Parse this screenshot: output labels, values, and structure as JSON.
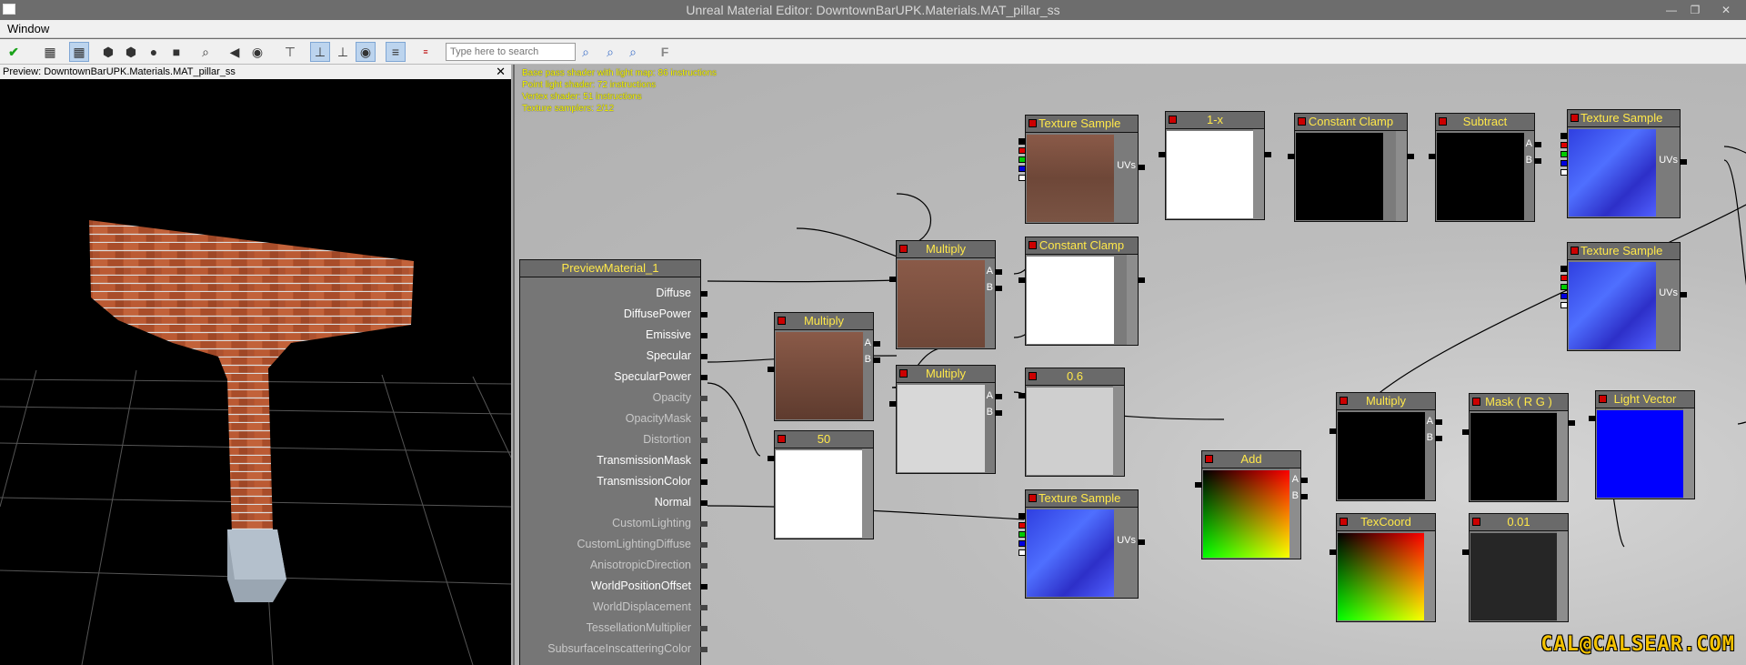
{
  "window": {
    "title": "Unreal Material Editor: DowntownBarUPK.Materials.MAT_pillar_ss"
  },
  "menu": {
    "items": [
      "Window"
    ]
  },
  "toolbar": {
    "search_placeholder": "Type here to search",
    "find_label": "F"
  },
  "preview": {
    "title": "Preview: DowntownBarUPK.Materials.MAT_pillar_ss",
    "close": "✕"
  },
  "stats": {
    "line1": "Base pass shader with light map: 86 instructions",
    "line2": "Point light shader: 72 instructions",
    "line3": "Vertex shader: 51 instructions",
    "line4": "Texture samplers: 2/12"
  },
  "material": {
    "title": "PreviewMaterial_1",
    "inputs": [
      {
        "label": "Diffuse",
        "active": true
      },
      {
        "label": "DiffusePower",
        "active": true
      },
      {
        "label": "Emissive",
        "active": true
      },
      {
        "label": "Specular",
        "active": true
      },
      {
        "label": "SpecularPower",
        "active": true
      },
      {
        "label": "Opacity",
        "active": false
      },
      {
        "label": "OpacityMask",
        "active": false
      },
      {
        "label": "Distortion",
        "active": false
      },
      {
        "label": "TransmissionMask",
        "active": true
      },
      {
        "label": "TransmissionColor",
        "active": true
      },
      {
        "label": "Normal",
        "active": true
      },
      {
        "label": "CustomLighting",
        "active": false
      },
      {
        "label": "CustomLightingDiffuse",
        "active": false
      },
      {
        "label": "AnisotropicDirection",
        "active": false
      },
      {
        "label": "WorldPositionOffset",
        "active": true
      },
      {
        "label": "WorldDisplacement",
        "active": false
      },
      {
        "label": "TessellationMultiplier",
        "active": false
      },
      {
        "label": "SubsurfaceInscatteringColor",
        "active": false
      }
    ]
  },
  "nodes": {
    "tex1": {
      "title": "Texture Sample",
      "pin": "UVs"
    },
    "oneminus": {
      "title": "1-x"
    },
    "clamp1": {
      "title": "Constant Clamp"
    },
    "subtract": {
      "title": "Subtract",
      "a": "A",
      "b": "B"
    },
    "tex_top": {
      "title": "Texture Sample",
      "pin": "UVs"
    },
    "mult1": {
      "title": "Multiply",
      "a": "A",
      "b": "B"
    },
    "clamp2": {
      "title": "Constant Clamp"
    },
    "tex_mid": {
      "title": "Texture Sample",
      "pin": "UVs"
    },
    "mult2": {
      "title": "Multiply",
      "a": "A",
      "b": "B"
    },
    "mult3": {
      "title": "Multiply",
      "a": "A",
      "b": "B"
    },
    "c06": {
      "title": "0.6"
    },
    "c50": {
      "title": "50"
    },
    "tex_normal": {
      "title": "Texture Sample",
      "pin": "UVs"
    },
    "add": {
      "title": "Add",
      "a": "A",
      "b": "B"
    },
    "mult4": {
      "title": "Multiply",
      "a": "A",
      "b": "B"
    },
    "mask": {
      "title": "Mask ( R G )"
    },
    "lightvec": {
      "title": "Light Vector"
    },
    "texcoord": {
      "title": "TexCoord"
    },
    "c001": {
      "title": "0.01"
    }
  },
  "watermark": {
    "text": "CAL@CALSEAR.COM"
  },
  "colors": {
    "header_text": "#ffe84a",
    "stats_text": "#ffff00",
    "watermark": "#f4c200"
  }
}
